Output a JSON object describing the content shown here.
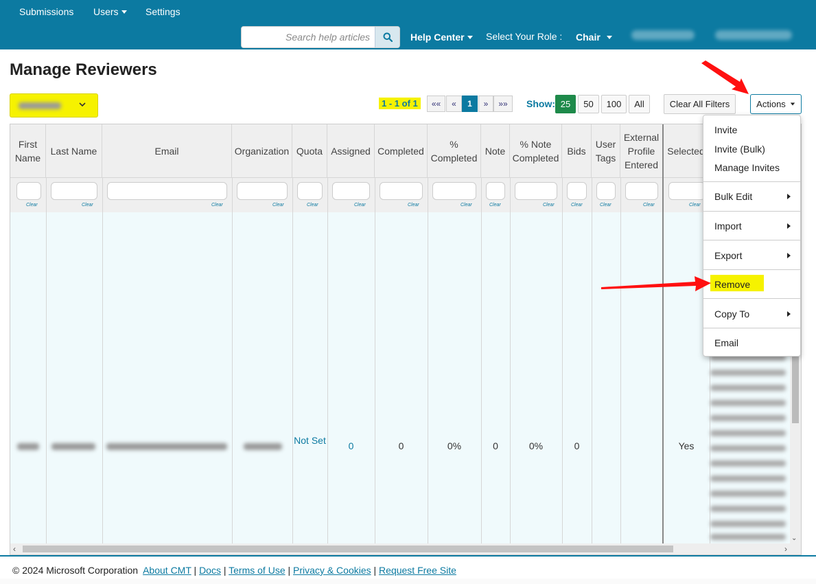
{
  "nav": {
    "submissions": "Submissions",
    "users": "Users",
    "settings": "Settings",
    "search_placeholder": "Search help articles",
    "help_center": "Help Center",
    "role_label": "Select Your Role :",
    "role_value": "Chair"
  },
  "page": {
    "title": "Manage Reviewers"
  },
  "pagination": {
    "range": "1 - 1 of 1",
    "first": "««",
    "prev": "«",
    "current": "1",
    "next": "»",
    "last": "»»",
    "show_label": "Show:",
    "sizes": [
      "25",
      "50",
      "100",
      "All"
    ],
    "active_size": "25"
  },
  "toolbar": {
    "clear_filters": "Clear All Filters",
    "actions": "Actions"
  },
  "table": {
    "columns": [
      "First Name",
      "Last Name",
      "Email",
      "Organization",
      "Quota",
      "Assigned",
      "Completed",
      "% Completed",
      "Note",
      "% Note Completed",
      "Bids",
      "User Tags",
      "External Profile Entered",
      "Selected"
    ],
    "filter_clear": "Clear",
    "row": {
      "quota": "Not Set",
      "assigned": "0",
      "completed": "0",
      "pct_completed": "0%",
      "note": "0",
      "pct_note_completed": "0%",
      "bids": "0",
      "selected": "Yes"
    }
  },
  "actions_menu": {
    "items": [
      "Invite",
      "Invite (Bulk)",
      "Manage Invites",
      "Bulk Edit",
      "Import",
      "Export",
      "Remove",
      "Copy To",
      "Email"
    ]
  },
  "footer": {
    "copyright": "© 2024 Microsoft Corporation",
    "links": [
      "About CMT",
      "Docs",
      "Terms of Use",
      "Privacy & Cookies",
      "Request Free Site"
    ]
  },
  "colors": {
    "header_bg": "#0c7aa1",
    "highlight": "#f6f200",
    "arrow": "#ff0000",
    "active_page": "#0c7aa1",
    "active_size": "#1e8a4a"
  }
}
